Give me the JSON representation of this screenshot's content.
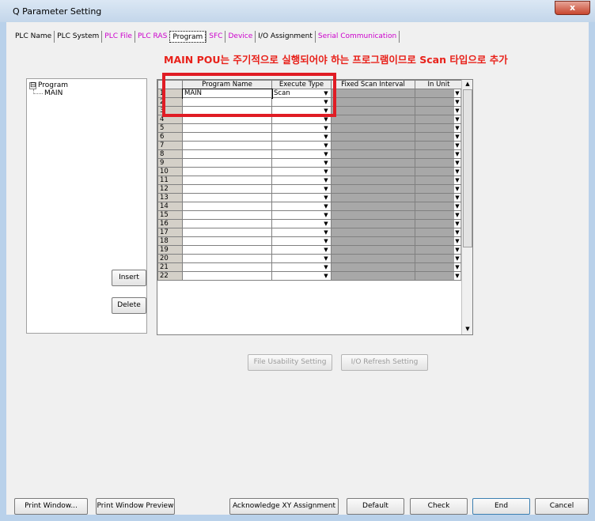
{
  "window": {
    "title": "Q Parameter Setting",
    "close_glyph": "x"
  },
  "tabs": [
    {
      "label": "PLC Name",
      "color": "#000000"
    },
    {
      "label": "PLC System",
      "color": "#000000"
    },
    {
      "label": "PLC File",
      "color": "#cc00cc"
    },
    {
      "label": "PLC RAS",
      "color": "#cc00cc"
    },
    {
      "label": "Program",
      "color": "#000000",
      "active": true
    },
    {
      "label": "SFC",
      "color": "#cc00cc"
    },
    {
      "label": "Device",
      "color": "#cc00cc"
    },
    {
      "label": "I/O Assignment",
      "color": "#000000"
    },
    {
      "label": "Serial Communication",
      "color": "#cc00cc"
    }
  ],
  "annotation": "MAIN POU는 주기적으로 실행되어야 하는 프로그램이므로 Scan 타입으로 추가",
  "tree": {
    "root": "Program",
    "toggle": "⊟",
    "child": "MAIN"
  },
  "grid": {
    "headers": [
      "",
      "Program Name",
      "Execute Type",
      "Fixed Scan Interval",
      "In Unit"
    ],
    "rows": [
      {
        "num": "1",
        "name": "MAIN",
        "exec": "Scan"
      },
      {
        "num": "2",
        "name": "",
        "exec": ""
      },
      {
        "num": "3",
        "name": "",
        "exec": ""
      },
      {
        "num": "4",
        "name": "",
        "exec": ""
      },
      {
        "num": "5",
        "name": "",
        "exec": ""
      },
      {
        "num": "6",
        "name": "",
        "exec": ""
      },
      {
        "num": "7",
        "name": "",
        "exec": ""
      },
      {
        "num": "8",
        "name": "",
        "exec": ""
      },
      {
        "num": "9",
        "name": "",
        "exec": ""
      },
      {
        "num": "10",
        "name": "",
        "exec": ""
      },
      {
        "num": "11",
        "name": "",
        "exec": ""
      },
      {
        "num": "12",
        "name": "",
        "exec": ""
      },
      {
        "num": "13",
        "name": "",
        "exec": ""
      },
      {
        "num": "14",
        "name": "",
        "exec": ""
      },
      {
        "num": "15",
        "name": "",
        "exec": ""
      },
      {
        "num": "16",
        "name": "",
        "exec": ""
      },
      {
        "num": "17",
        "name": "",
        "exec": ""
      },
      {
        "num": "18",
        "name": "",
        "exec": ""
      },
      {
        "num": "19",
        "name": "",
        "exec": ""
      },
      {
        "num": "20",
        "name": "",
        "exec": ""
      },
      {
        "num": "21",
        "name": "",
        "exec": ""
      },
      {
        "num": "22",
        "name": "",
        "exec": ""
      }
    ]
  },
  "side_buttons": {
    "insert": "Insert",
    "delete": "Delete"
  },
  "mid_buttons": {
    "file_usability": "File Usability Setting",
    "io_refresh": "I/O Refresh Setting"
  },
  "bottom_buttons": {
    "print_window": "Print Window...",
    "print_preview": "Print Window Preview",
    "ack_xy": "Acknowledge XY Assignment",
    "default": "Default",
    "check": "Check",
    "end": "End",
    "cancel": "Cancel"
  },
  "colors": {
    "highlight": "#e01c24",
    "annotation": "#e8211a",
    "disabled_cell": "#a8a8a8"
  }
}
